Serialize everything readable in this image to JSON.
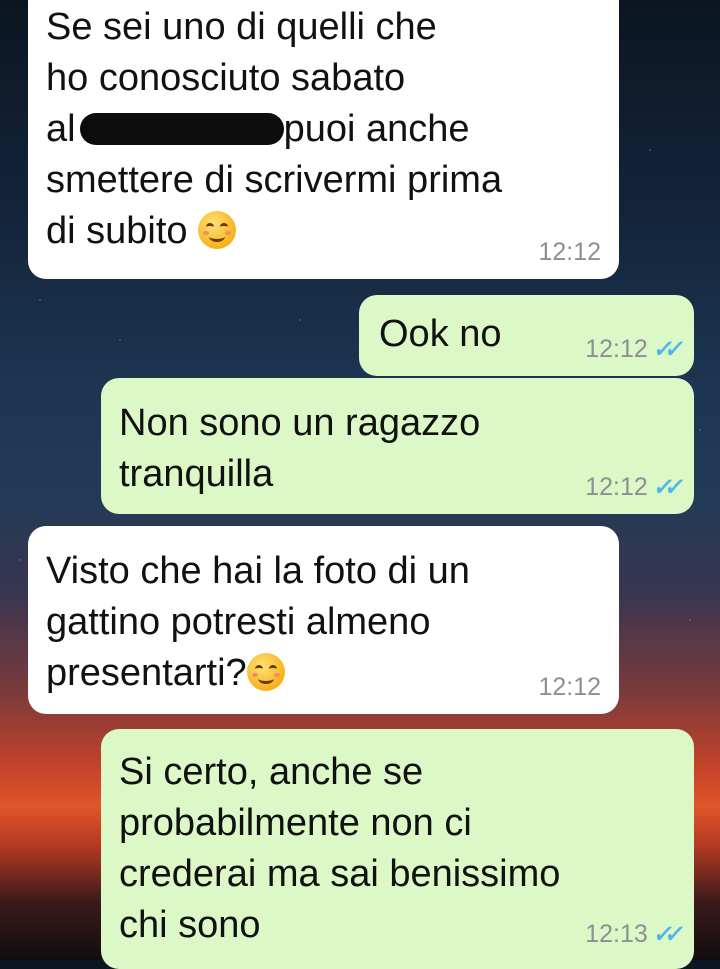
{
  "theme": {
    "incoming_bg": "#ffffff",
    "outgoing_bg": "#dcf8c6",
    "read_tick_color": "#4fb6ec",
    "time_color": "#8a9096"
  },
  "messages": [
    {
      "direction": "incoming",
      "lines": [
        "Se sei uno di quelli che",
        "ho conosciuto sabato",
        "al",
        "puoi anche",
        "smettere di scrivermi prima",
        "di subito"
      ],
      "time": "12:12",
      "has_redaction": true,
      "emoji": "smiling-face-icon"
    },
    {
      "direction": "outgoing",
      "text": "Ook no",
      "time": "12:12",
      "status": "read"
    },
    {
      "direction": "outgoing",
      "text": "Non sono un ragazzo\ntranquilla",
      "time": "12:12",
      "status": "read"
    },
    {
      "direction": "incoming",
      "text": "Visto che hai la foto di un\ngattino potresti almeno\npresentarti?",
      "time": "12:12",
      "emoji": "smiling-face-icon"
    },
    {
      "direction": "outgoing",
      "text": "Si certo, anche se\nprobabilmente non ci\ncrederai ma sai benissimo\nchi sono",
      "time": "12:13",
      "status": "read"
    }
  ],
  "read_ticks": "✓✓"
}
